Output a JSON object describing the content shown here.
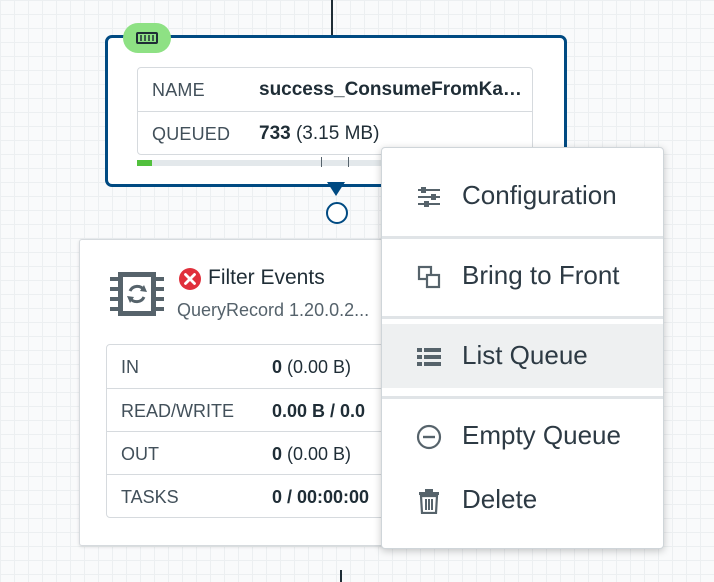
{
  "connection": {
    "name_label": "NAME",
    "name_value": "success_ConsumeFromKa…",
    "queued_label": "QUEUED",
    "queued_count": "733",
    "queued_size": " (3.15 MB)",
    "progress_fraction": 0.05
  },
  "processor": {
    "name": "Filter Events",
    "type": "QueryRecord 1.20.0.2...",
    "stats": [
      {
        "label": "IN",
        "value_bold": "0",
        "value_rest": " (0.00 B)"
      },
      {
        "label": "READ/WRITE",
        "value_bold": "0.00 B / 0.0",
        "value_rest": ""
      },
      {
        "label": "OUT",
        "value_bold": "0",
        "value_rest": " (0.00 B)"
      },
      {
        "label": "TASKS",
        "value_bold": "0 / 00:00:00",
        "value_rest": ""
      }
    ]
  },
  "context_menu": {
    "items": [
      {
        "label": "Configuration",
        "icon": "sliders-icon"
      },
      {
        "label": "Bring to Front",
        "icon": "bring-to-front-icon"
      },
      {
        "label": "List Queue",
        "icon": "list-icon"
      },
      {
        "label": "Empty Queue",
        "icon": "minus-circle-icon"
      },
      {
        "label": "Delete",
        "icon": "trash-icon"
      }
    ]
  },
  "colors": {
    "connection_border": "#004a82",
    "badge": "#8ee184",
    "progress": "#52c03d",
    "error": "#e0303c",
    "menu_hover": "#eef0f1"
  }
}
